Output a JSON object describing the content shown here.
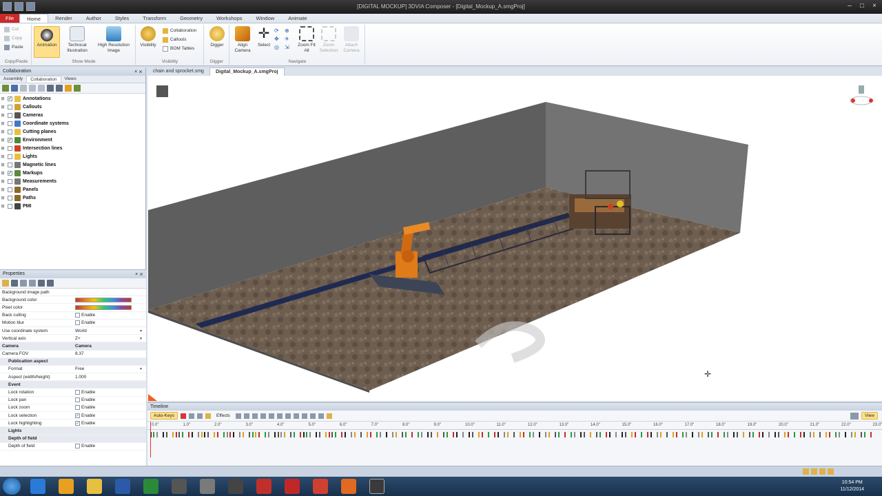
{
  "window": {
    "title": "[DIGITAL MOCKUP] 3DVIA Composer - [Digital_Mockup_A.smgProj]"
  },
  "ribbon_tabs": [
    "File",
    "Home",
    "Render",
    "Author",
    "Styles",
    "Transform",
    "Geometry",
    "Workshops",
    "Window",
    "Animate"
  ],
  "ribbon": {
    "copy_paste": {
      "cut": "Cut",
      "copy": "Copy",
      "paste": "Paste",
      "label": "Copy/Paste"
    },
    "show_mode": {
      "animation": "Animation",
      "technical": "Technical Illustration",
      "highres": "High Resolution Image",
      "label": "Show Mode"
    },
    "visibility": {
      "visibility": "Visibility",
      "collaboration": "Collaboration",
      "callouts": "Callouts",
      "bom": "BOM Tables",
      "label": "Visibility"
    },
    "digger": {
      "digger": "Digger",
      "label": "Digger"
    },
    "navigate": {
      "align": "Align Camera",
      "select": "Select",
      "zoom_fit": "Zoom Fit All",
      "zoom_sel": "Zoom Selection",
      "attach": "Attach Camera",
      "label": "Navigate"
    }
  },
  "left_panel": {
    "title": "Collaboration",
    "subtabs": [
      "Assembly",
      "Collaboration",
      "Views"
    ],
    "tree": [
      {
        "label": "Annotations",
        "checked": true
      },
      {
        "label": "Callouts",
        "checked": false
      },
      {
        "label": "Cameras",
        "checked": false
      },
      {
        "label": "Coordinate systems",
        "checked": false
      },
      {
        "label": "Cutting planes",
        "checked": false
      },
      {
        "label": "Environment",
        "checked": true
      },
      {
        "label": "Intersection lines",
        "checked": false
      },
      {
        "label": "Lights",
        "checked": false
      },
      {
        "label": "Magnetic lines",
        "checked": false
      },
      {
        "label": "Markups",
        "checked": true
      },
      {
        "label": "Measurements",
        "checked": false
      },
      {
        "label": "Panels",
        "checked": false
      },
      {
        "label": "Paths",
        "checked": false
      },
      {
        "label": "PMI",
        "checked": false
      }
    ]
  },
  "properties": {
    "title": "Properties",
    "rows": [
      {
        "name": "Background image path",
        "value": ""
      },
      {
        "name": "Background color",
        "value": "",
        "type": "grad"
      },
      {
        "name": "Pixel color",
        "value": "",
        "type": "grad"
      },
      {
        "name": "Back culling",
        "value": "Enable",
        "type": "cb",
        "checked": false
      },
      {
        "name": "Motion blur",
        "value": "Enable",
        "type": "cb",
        "checked": false
      },
      {
        "name": "Use coordinate system",
        "value": "World",
        "type": "dd"
      },
      {
        "name": "Vertical axis",
        "value": "Z+",
        "type": "dd"
      },
      {
        "name": "Camera",
        "value": "Camera",
        "type": "cat"
      },
      {
        "name": "Camera FOV",
        "value": "8.37"
      },
      {
        "name": "Publication aspect",
        "value": "",
        "type": "catsub"
      },
      {
        "name": "Format",
        "value": "Free",
        "type": "dd",
        "sub": true
      },
      {
        "name": "Aspect (width/height)",
        "value": "1.000",
        "sub": true
      },
      {
        "name": "Event",
        "value": "",
        "type": "catsub"
      },
      {
        "name": "Lock rotation",
        "value": "Enable",
        "type": "cb",
        "sub": true,
        "checked": false
      },
      {
        "name": "Lock pan",
        "value": "Enable",
        "type": "cb",
        "sub": true,
        "checked": false
      },
      {
        "name": "Lock zoom",
        "value": "Enable",
        "type": "cb",
        "sub": true,
        "checked": false
      },
      {
        "name": "Lock selection",
        "value": "Enable",
        "type": "cb",
        "sub": true,
        "checked": true
      },
      {
        "name": "Lock highlighting",
        "value": "Enable",
        "type": "cb",
        "sub": true,
        "checked": true
      },
      {
        "name": "Lights",
        "value": "",
        "type": "catsub"
      },
      {
        "name": "Depth of field",
        "value": "",
        "type": "catsub"
      },
      {
        "name": "Depth of field",
        "value": "Enable",
        "type": "cb",
        "sub": true,
        "checked": false
      }
    ]
  },
  "document_tabs": [
    "chain and sprocket.smg",
    "Digital_Mockup_A.smgProj"
  ],
  "timeline": {
    "title": "Timeline",
    "auto_keys": "Auto-Keys",
    "effects": "Effects",
    "time_ticks": [
      "0.0\"",
      "1.0\"",
      "2.0\"",
      "3.0\"",
      "4.0\"",
      "5.0\"",
      "6.0\"",
      "7.0\"",
      "8.0\"",
      "9.0\"",
      "10.0\"",
      "11.0\"",
      "12.0\"",
      "13.0\"",
      "14.0\"",
      "15.0\"",
      "16.0\"",
      "17.0\"",
      "18.0\"",
      "19.0\"",
      "20.0\"",
      "21.0\"",
      "22.0\"",
      "23.0\""
    ],
    "view_label": "View"
  },
  "taskbar": {
    "time": "10:54 PM",
    "date": "11/12/2014"
  },
  "colors": {
    "accent": "#ffe08a",
    "file_tab": "#c92a2a",
    "robot": "#e07b1a",
    "wall": "#5a5a5a",
    "floor": "#6e5a48"
  }
}
